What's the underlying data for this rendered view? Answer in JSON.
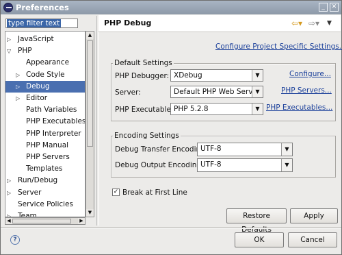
{
  "window": {
    "title": "Preferences"
  },
  "filter": {
    "text": "type filter text"
  },
  "tree": [
    {
      "label": "JavaScript",
      "indent": 0,
      "twisty": "collapsed"
    },
    {
      "label": "PHP",
      "indent": 0,
      "twisty": "expanded"
    },
    {
      "label": "Appearance",
      "indent": 1,
      "twisty": "none"
    },
    {
      "label": "Code Style",
      "indent": 1,
      "twisty": "collapsed"
    },
    {
      "label": "Debug",
      "indent": 1,
      "twisty": "collapsed",
      "selected": true
    },
    {
      "label": "Editor",
      "indent": 1,
      "twisty": "collapsed"
    },
    {
      "label": "Path Variables",
      "indent": 1,
      "twisty": "none"
    },
    {
      "label": "PHP Executables",
      "indent": 1,
      "twisty": "none"
    },
    {
      "label": "PHP Interpreter",
      "indent": 1,
      "twisty": "none"
    },
    {
      "label": "PHP Manual",
      "indent": 1,
      "twisty": "none"
    },
    {
      "label": "PHP Servers",
      "indent": 1,
      "twisty": "none"
    },
    {
      "label": "Templates",
      "indent": 1,
      "twisty": "none"
    },
    {
      "label": "Run/Debug",
      "indent": 0,
      "twisty": "collapsed"
    },
    {
      "label": "Server",
      "indent": 0,
      "twisty": "collapsed"
    },
    {
      "label": "Service Policies",
      "indent": 0,
      "twisty": "none"
    },
    {
      "label": "Team",
      "indent": 0,
      "twisty": "collapsed"
    }
  ],
  "page": {
    "title": "PHP Debug",
    "configure_project_link": "Configure Project Specific Settings...",
    "default_settings": {
      "title": "Default Settings",
      "debugger_label": "PHP Debugger:",
      "debugger_value": "XDebug",
      "configure_link": "Configure...",
      "server_label": "Server:",
      "server_value": "Default PHP Web Server",
      "servers_link": "PHP Servers...",
      "executable_label": "PHP Executable:",
      "executable_value": "PHP 5.2.8",
      "executables_link": "PHP Executables..."
    },
    "encoding_settings": {
      "title": "Encoding Settings",
      "transfer_label": "Debug Transfer Encoding",
      "transfer_value": "UTF-8",
      "output_label": "Debug Output Encoding",
      "output_value": "UTF-8"
    },
    "break_first_line": {
      "label": "Break at First Line",
      "checked": true
    },
    "restore_defaults": "Restore Defaults",
    "apply": "Apply"
  },
  "footer": {
    "ok": "OK",
    "cancel": "Cancel"
  },
  "icons": {
    "app": "eclipse-icon",
    "help": "help-icon"
  }
}
